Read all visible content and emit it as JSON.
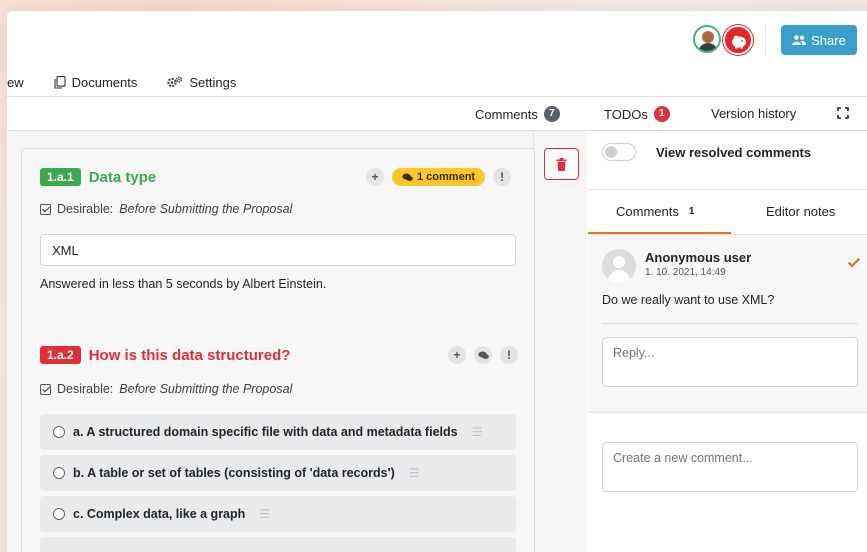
{
  "header": {
    "share_label": "Share"
  },
  "nav": {
    "items": [
      {
        "label": "ew"
      },
      {
        "label": "Documents"
      },
      {
        "label": "Settings"
      }
    ]
  },
  "subbar": {
    "comments_label": "Comments",
    "comments_count": "7",
    "todos_label": "TODOs",
    "todos_count": "1",
    "version_history_label": "Version history"
  },
  "questions": [
    {
      "number": "1.a.1",
      "title": "Data type",
      "color": "#3ba94e",
      "comment_pill": "1 comment",
      "desirable_prefix": "Desirable:",
      "desirable_phase": "Before Submitting the Proposal",
      "answer_value": "XML",
      "answered_text": "Answered in less than 5 seconds by Albert Einstein."
    },
    {
      "number": "1.a.2",
      "title": "How is this data structured?",
      "color": "#e02e3a",
      "desirable_prefix": "Desirable:",
      "desirable_phase": "Before Submitting the Proposal",
      "options": [
        {
          "label": "a. A structured domain specific file with data and metadata fields"
        },
        {
          "label": "b. A table or set of tables (consisting of 'data records')"
        },
        {
          "label": "c. Complex data, like a graph"
        }
      ]
    }
  ],
  "right_panel": {
    "toggle_label": "View resolved comments",
    "tabs": [
      {
        "label": "Comments",
        "count": "1"
      },
      {
        "label": "Editor notes"
      }
    ],
    "comment": {
      "author": "Anonymous user",
      "date": "1. 10. 2021, 14:49",
      "text": "Do we really want to use XML?"
    },
    "reply_placeholder": "Reply...",
    "new_comment_placeholder": "Create a new comment..."
  },
  "colors": {
    "accent": "#f06b2c",
    "share": "#3a9fc9",
    "danger": "#e02e3a",
    "success": "#3ba94e",
    "warning": "#ffc629"
  },
  "icons": [
    "documents-icon",
    "settings-icon",
    "users-icon",
    "trash-icon",
    "plus-icon",
    "comment-icon",
    "exclamation-icon",
    "check-icon",
    "expand-icon",
    "list-icon"
  ]
}
